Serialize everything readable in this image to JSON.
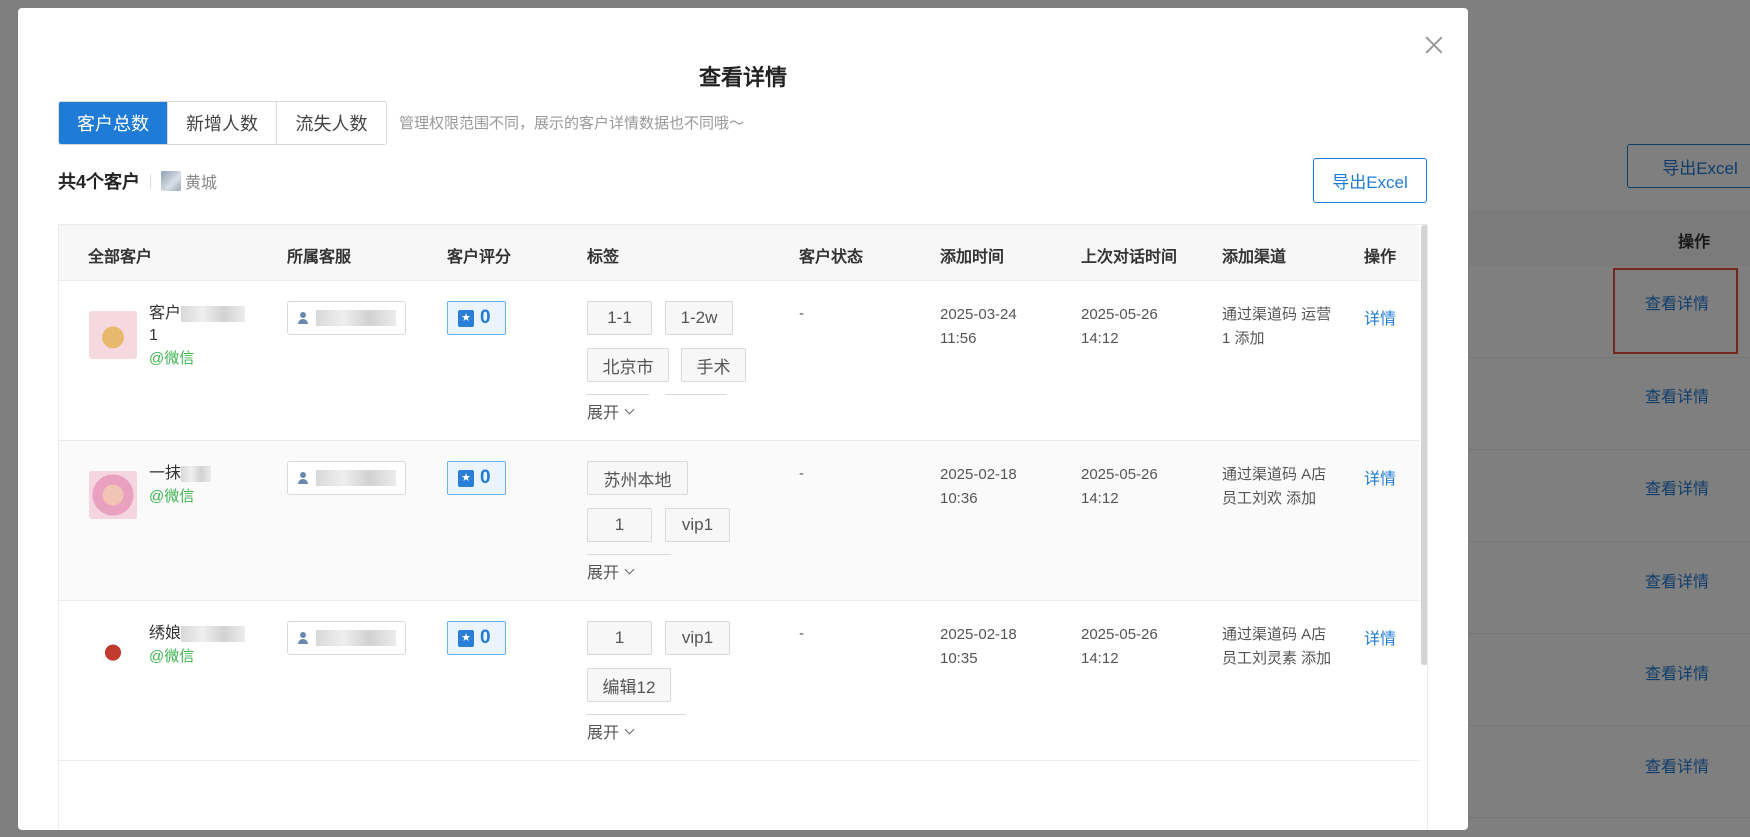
{
  "background": {
    "export_label": "导出Excel",
    "column_operation": "操作",
    "row_links": [
      "查看详情",
      "查看详情",
      "查看详情",
      "查看详情",
      "查看详情",
      "查看详情"
    ],
    "highlight_color": "#e0513f"
  },
  "modal": {
    "title": "查看详情",
    "tabs": [
      "客户总数",
      "新增人数",
      "流失人数"
    ],
    "hint": "管理权限范围不同，展示的客户详情数据也不同哦～",
    "summary": {
      "count_label": "共4个客户",
      "owner_name": "黄城"
    },
    "export_label": "导出Excel",
    "accent_color": "#1f7bd6"
  },
  "table": {
    "columns": [
      "全部客户",
      "所属客服",
      "客户评分",
      "标签",
      "客户状态",
      "添加时间",
      "上次对话时间",
      "添加渠道",
      "操作"
    ],
    "rows": [
      {
        "name_prefix": "客户",
        "name_suffix": "1",
        "channel": "@微信",
        "score": "0",
        "tags": [
          "1-1",
          "1-2w",
          "北京市",
          "手术"
        ],
        "expand": "展开",
        "status": "-",
        "add_date": "2025-03-24",
        "add_time": "11:56",
        "last_date": "2025-05-26",
        "last_time": "14:12",
        "source": "通过渠道码 运营1 添加",
        "action": "详情"
      },
      {
        "name_prefix": "一抹",
        "name_suffix": "",
        "channel": "@微信",
        "score": "0",
        "tags": [
          "苏州本地",
          "1",
          "vip1"
        ],
        "expand": "展开",
        "status": "-",
        "add_date": "2025-02-18",
        "add_time": "10:36",
        "last_date": "2025-05-26",
        "last_time": "14:12",
        "source": "通过渠道码 A店员工刘欢 添加",
        "action": "详情"
      },
      {
        "name_prefix": "绣娘",
        "name_suffix": "",
        "channel": "@微信",
        "score": "0",
        "tags": [
          "1",
          "vip1",
          "编辑12"
        ],
        "expand": "展开",
        "status": "-",
        "add_date": "2025-02-18",
        "add_time": "10:35",
        "last_date": "2025-05-26",
        "last_time": "14:12",
        "source": "通过渠道码 A店员工刘灵素 添加",
        "action": "详情"
      }
    ]
  }
}
